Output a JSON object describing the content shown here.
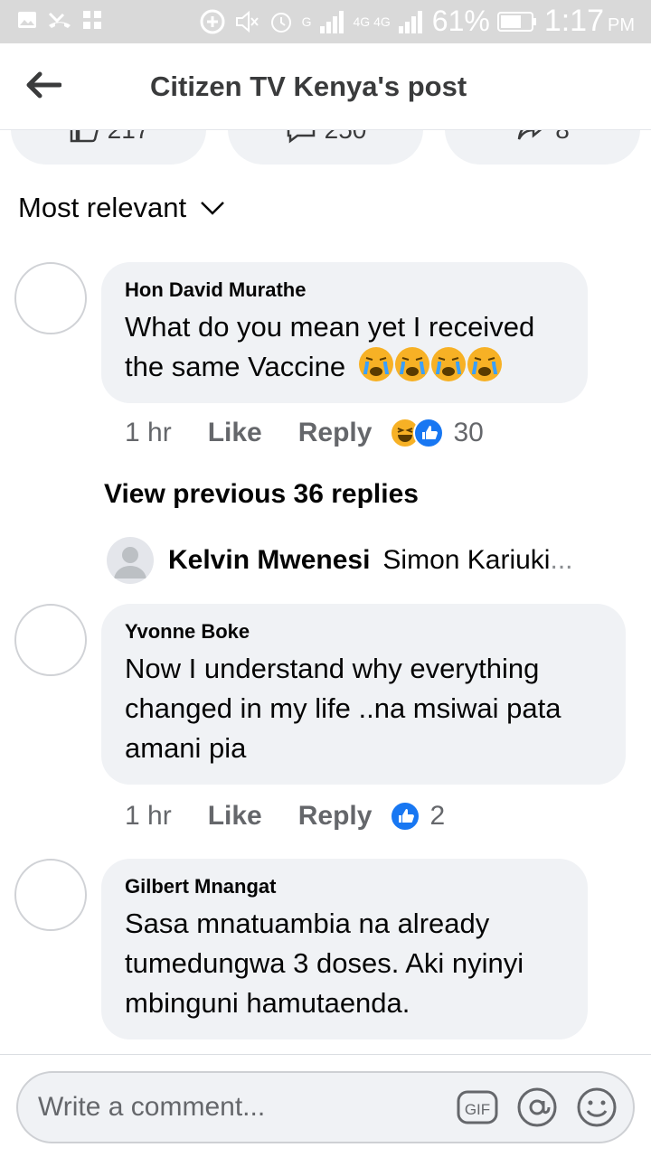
{
  "status_bar": {
    "signal_label_1": "G",
    "signal_label_2": "4G 4G",
    "battery": "61%",
    "time": "1:17",
    "ampm": "PM"
  },
  "header": {
    "title": "Citizen TV Kenya's post"
  },
  "reactions_bar": {
    "likes": "217",
    "comments": "250",
    "shares": "8"
  },
  "sort": {
    "label": "Most relevant"
  },
  "comments": [
    {
      "author": "Hon David Murathe",
      "text": "What do you mean yet I received the same Vaccine",
      "emoji_count": 4,
      "time": "1 hr",
      "like_label": "Like",
      "reply_label": "Reply",
      "reaction_count": "30"
    },
    {
      "author": "Yvonne Boke",
      "text": "Now I understand why everything changed in my life ..na msiwai pata amani pia",
      "time": "1 hr",
      "like_label": "Like",
      "reply_label": "Reply",
      "reaction_count": "2"
    },
    {
      "author": "Gilbert Mnangat",
      "text": "Sasa mnatuambia na already tumedungwa 3 doses. Aki nyinyi mbinguni hamutaenda."
    }
  ],
  "replies": {
    "view_previous": "View previous 36 replies",
    "reply_author": "Kelvin Mwenesi",
    "reply_snippet": "Simon Kariuki",
    "ellipsis": "..."
  },
  "composer": {
    "placeholder": "Write a comment...",
    "gif_label": "GIF"
  },
  "colors": {
    "bubble": "#f0f2f5",
    "meta": "#65676b",
    "like_blue": "#1877f2",
    "haha_yellow": "#f7b125"
  }
}
